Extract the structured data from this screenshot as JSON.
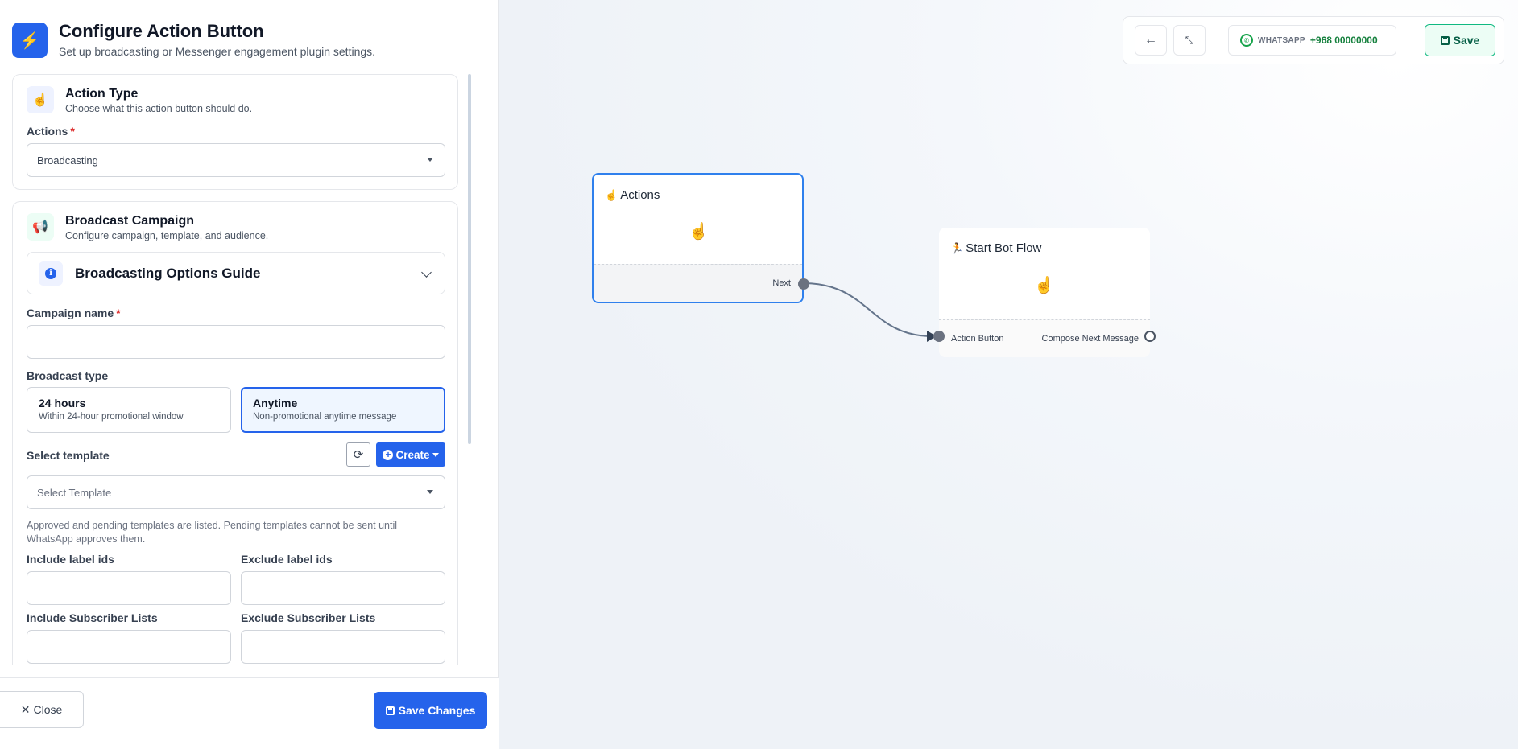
{
  "panel": {
    "title": "Configure Action Button",
    "subtitle": "Set up broadcasting or Messenger engagement plugin settings.",
    "action_type": {
      "title": "Action Type",
      "subtitle": "Choose what this action button should do.",
      "actions_label": "Actions",
      "required_mark": "*",
      "actions_value": "Broadcasting"
    },
    "broadcast": {
      "title": "Broadcast Campaign",
      "subtitle": "Configure campaign, template, and audience.",
      "guide_title": "Broadcasting Options Guide",
      "campaign_label": "Campaign name",
      "campaign_value": "",
      "broadcast_type_label": "Broadcast type",
      "options": [
        {
          "title": "24 hours",
          "subtitle": "Within 24-hour promotional window",
          "selected": false
        },
        {
          "title": "Anytime",
          "subtitle": "Non-promotional anytime message",
          "selected": true
        }
      ],
      "template_label": "Select template",
      "create_label": "Create",
      "template_placeholder": "Select Template",
      "help_text": "Approved and pending templates are listed. Pending templates cannot be sent until WhatsApp approves them.",
      "include_labels": "Include label ids",
      "exclude_labels": "Exclude label ids",
      "include_lists": "Include Subscriber Lists",
      "exclude_lists": "Exclude Subscriber Lists"
    },
    "footer": {
      "close_label": "Close",
      "save_label": "Save Changes"
    }
  },
  "toolbar": {
    "whatsapp_label": "WHATSAPP",
    "phone": "+968 00000000",
    "save_label": "Save"
  },
  "nodes": {
    "actions": {
      "title": "Actions",
      "port_next": "Next"
    },
    "start": {
      "title": "Start Bot Flow",
      "port_in": "Action Button",
      "port_out": "Compose Next Message"
    }
  },
  "colors": {
    "accent": "#2563eb",
    "success": "#10b981",
    "edge": "#64748b"
  }
}
